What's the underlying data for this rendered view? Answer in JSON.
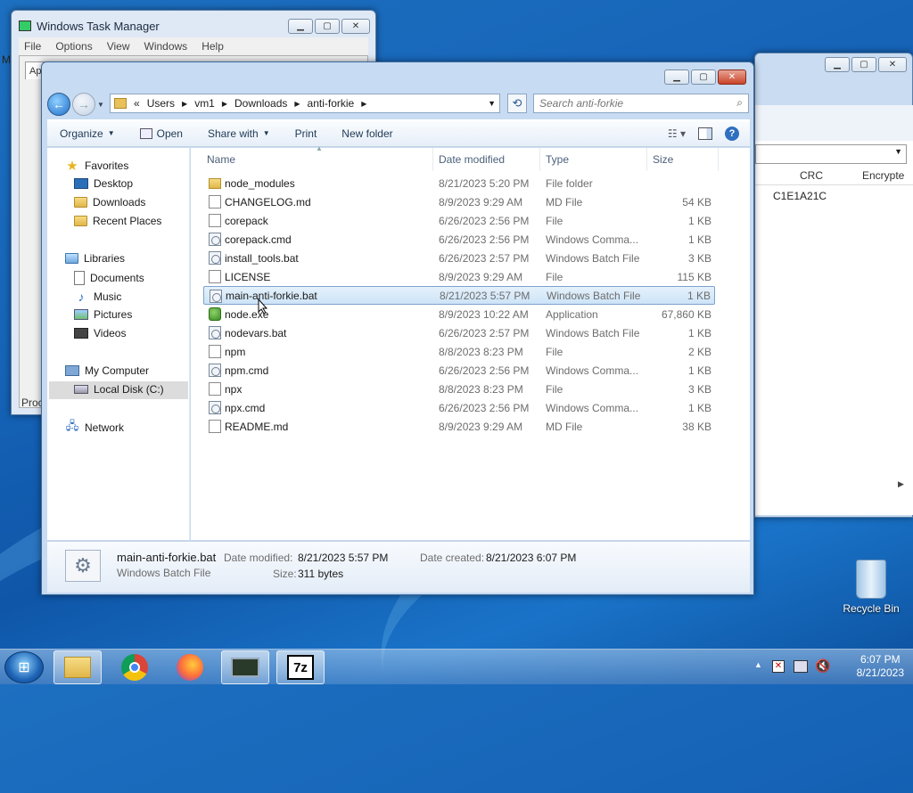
{
  "colors": {
    "accent": "#2f6fc0",
    "selection": "#cde4f7",
    "desktop": "#1664b8"
  },
  "task_manager": {
    "title": "Windows Task Manager",
    "menus": [
      "File",
      "Options",
      "View",
      "Windows",
      "Help"
    ],
    "tab_partial": "App",
    "proc_partial": "Proc"
  },
  "back_window": {
    "columns": [
      "CRC",
      "Encrypte"
    ],
    "crc_value": "C1E1A21C",
    "left_partial": "M"
  },
  "explorer": {
    "breadcrumb": [
      "«",
      "Users",
      "vm1",
      "Downloads",
      "anti-forkie"
    ],
    "search_placeholder": "Search anti-forkie",
    "toolbar": {
      "organize": "Organize",
      "open": "Open",
      "share_with": "Share with",
      "print": "Print",
      "new_folder": "New folder"
    },
    "nav": {
      "favorites": "Favorites",
      "desktop": "Desktop",
      "downloads": "Downloads",
      "recent_places": "Recent Places",
      "libraries": "Libraries",
      "documents": "Documents",
      "music": "Music",
      "pictures": "Pictures",
      "videos": "Videos",
      "my_computer": "My Computer",
      "local_disk": "Local Disk (C:)",
      "network": "Network"
    },
    "columns": {
      "name": "Name",
      "date": "Date modified",
      "type": "Type",
      "size": "Size"
    },
    "files": [
      {
        "name": "node_modules",
        "date": "8/21/2023 5:20 PM",
        "type": "File folder",
        "size": "",
        "icon": "folder"
      },
      {
        "name": "CHANGELOG.md",
        "date": "8/9/2023 9:29 AM",
        "type": "MD File",
        "size": "54 KB",
        "icon": "file"
      },
      {
        "name": "corepack",
        "date": "6/26/2023 2:56 PM",
        "type": "File",
        "size": "1 KB",
        "icon": "file"
      },
      {
        "name": "corepack.cmd",
        "date": "6/26/2023 2:56 PM",
        "type": "Windows Comma...",
        "size": "1 KB",
        "icon": "bat"
      },
      {
        "name": "install_tools.bat",
        "date": "6/26/2023 2:57 PM",
        "type": "Windows Batch File",
        "size": "3 KB",
        "icon": "bat"
      },
      {
        "name": "LICENSE",
        "date": "8/9/2023 9:29 AM",
        "type": "File",
        "size": "115 KB",
        "icon": "file"
      },
      {
        "name": "main-anti-forkie.bat",
        "date": "8/21/2023 5:57 PM",
        "type": "Windows Batch File",
        "size": "1 KB",
        "icon": "bat"
      },
      {
        "name": "node.exe",
        "date": "8/9/2023 10:22 AM",
        "type": "Application",
        "size": "67,860 KB",
        "icon": "app"
      },
      {
        "name": "nodevars.bat",
        "date": "6/26/2023 2:57 PM",
        "type": "Windows Batch File",
        "size": "1 KB",
        "icon": "bat"
      },
      {
        "name": "npm",
        "date": "8/8/2023 8:23 PM",
        "type": "File",
        "size": "2 KB",
        "icon": "file"
      },
      {
        "name": "npm.cmd",
        "date": "6/26/2023 2:56 PM",
        "type": "Windows Comma...",
        "size": "1 KB",
        "icon": "bat"
      },
      {
        "name": "npx",
        "date": "8/8/2023 8:23 PM",
        "type": "File",
        "size": "3 KB",
        "icon": "file"
      },
      {
        "name": "npx.cmd",
        "date": "6/26/2023 2:56 PM",
        "type": "Windows Comma...",
        "size": "1 KB",
        "icon": "bat"
      },
      {
        "name": "README.md",
        "date": "8/9/2023 9:29 AM",
        "type": "MD File",
        "size": "38 KB",
        "icon": "file"
      }
    ],
    "selected_index": 6,
    "details": {
      "filename": "main-anti-forkie.bat",
      "type": "Windows Batch File",
      "date_modified_label": "Date modified:",
      "date_modified": "8/21/2023 5:57 PM",
      "size_label": "Size:",
      "size": "311 bytes",
      "date_created_label": "Date created:",
      "date_created": "8/21/2023 6:07 PM"
    }
  },
  "desktop": {
    "recycle_bin": "Recycle Bin"
  },
  "taskbar": {
    "time": "6:07 PM",
    "date": "8/21/2023",
    "apps": [
      "explorer-icon",
      "chrome-icon",
      "firefox-icon",
      "task-manager-icon",
      "7zip-icon"
    ],
    "sevenzip_label": "7z"
  }
}
